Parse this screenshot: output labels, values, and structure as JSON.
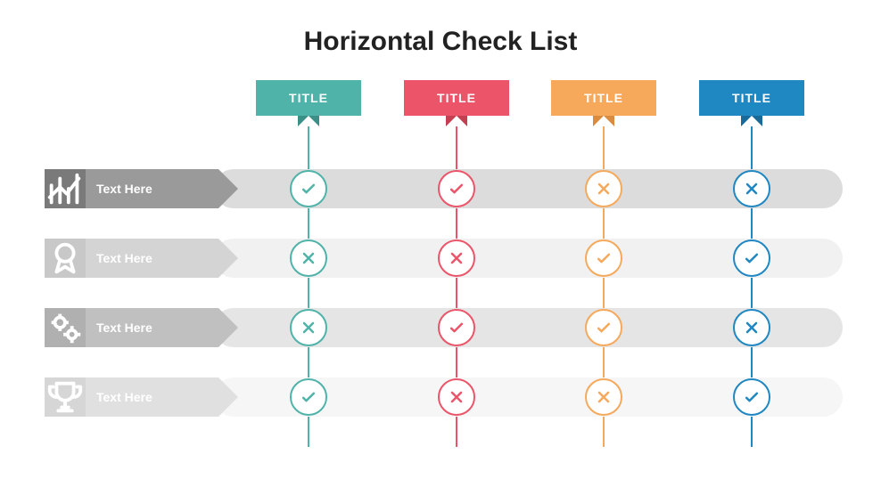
{
  "title": "Horizontal Check List",
  "columns": [
    {
      "label": "TITLE",
      "color": "#4fb3a9",
      "dark": "#3a8f86"
    },
    {
      "label": "TITLE",
      "color": "#ec5569",
      "dark": "#c43f52"
    },
    {
      "label": "TITLE",
      "color": "#f6a95b",
      "dark": "#d98c3f"
    },
    {
      "label": "TITLE",
      "color": "#1f87c2",
      "dark": "#176a99"
    }
  ],
  "rows": [
    {
      "label": "Text Here",
      "icon": "chart-up-icon",
      "iconBg": "#7a7a7a",
      "textBg": "#9a9a9a",
      "barBg": "#dcdcdc"
    },
    {
      "label": "Text Here",
      "icon": "award-icon",
      "iconBg": "#c8c8c8",
      "textBg": "#d4d4d4",
      "barBg": "#f1f1f1"
    },
    {
      "label": "Text Here",
      "icon": "gears-icon",
      "iconBg": "#b0b0b0",
      "textBg": "#c0c0c0",
      "barBg": "#e5e5e5"
    },
    {
      "label": "Text Here",
      "icon": "trophy-icon",
      "iconBg": "#d6d6d6",
      "textBg": "#e0e0e0",
      "barBg": "#f6f6f6"
    }
  ],
  "grid": [
    [
      "check",
      "check",
      "cross",
      "cross"
    ],
    [
      "cross",
      "cross",
      "check",
      "check"
    ],
    [
      "cross",
      "check",
      "check",
      "cross"
    ],
    [
      "check",
      "cross",
      "cross",
      "check"
    ]
  ],
  "layout": {
    "colX": [
      296,
      462,
      627,
      793
    ],
    "rowY": [
      122,
      200,
      278,
      356
    ]
  }
}
